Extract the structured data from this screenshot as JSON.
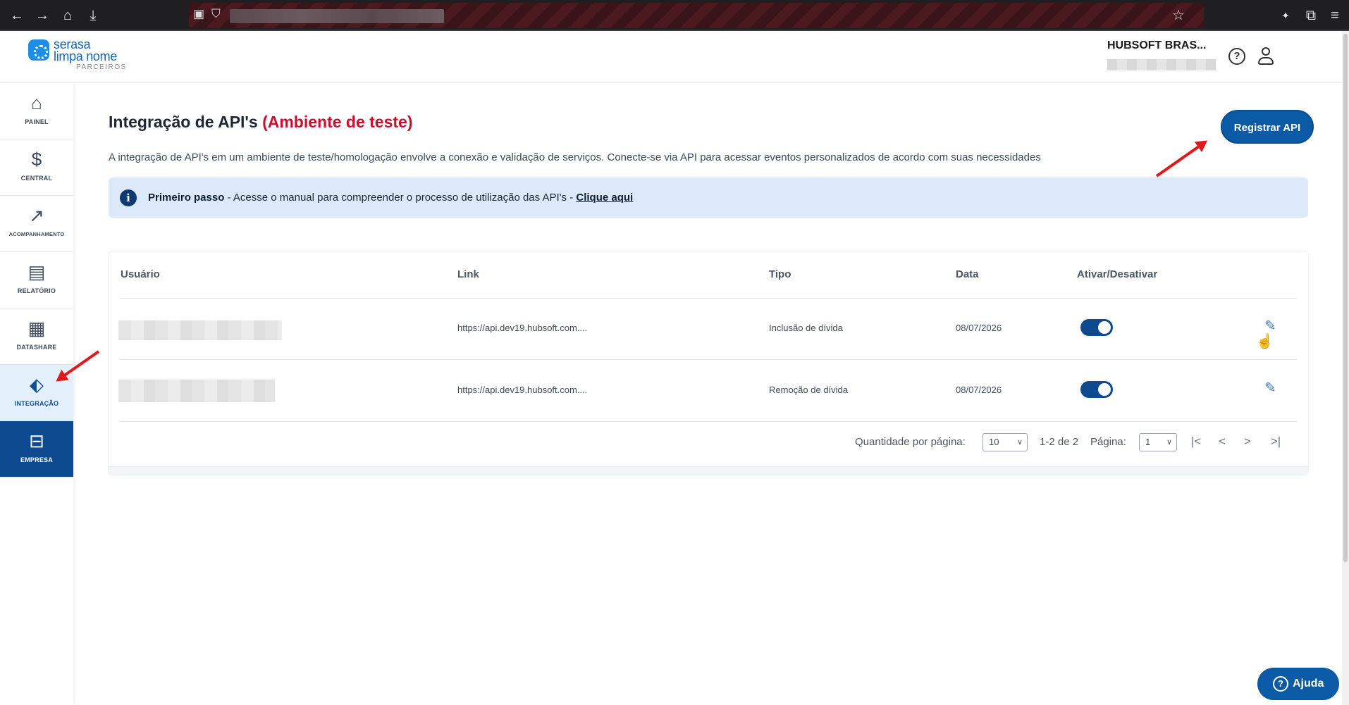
{
  "browser": {
    "back": "←",
    "forward": "→",
    "home": "⌂",
    "download": "⤓",
    "star": "☆",
    "menu": "≡"
  },
  "header": {
    "logo_line1": "serasa",
    "logo_line2": "limpa nome",
    "logo_line3": "PARCEIROS",
    "company_name": "HUBSOFT BRAS...",
    "help_symbol": "?"
  },
  "sidebar": {
    "items": [
      {
        "label": "PAINEL",
        "icon": "home-icon",
        "glyph": "⌂"
      },
      {
        "label": "CENTRAL",
        "icon": "money-hand-icon",
        "glyph": "$"
      },
      {
        "label": "ACOMPANHAMENTO",
        "icon": "trend-icon",
        "glyph": "↗"
      },
      {
        "label": "RELATÓRIO",
        "icon": "report-icon",
        "glyph": "▤"
      },
      {
        "label": "DATASHARE",
        "icon": "grid-icon",
        "glyph": "▦"
      },
      {
        "label": "INTEGRAÇÃO",
        "icon": "integration-icon",
        "glyph": "⬖"
      },
      {
        "label": "EMPRESA",
        "icon": "briefcase-icon",
        "glyph": "⊟"
      }
    ]
  },
  "main": {
    "title": "Integração de API's",
    "title_accent": "(Ambiente de teste)",
    "register_button": "Registrar API",
    "description": "A integração de API's em um ambiente de teste/homologação envolve a conexão e validação de serviços. Conecte-se via API para acessar eventos personalizados de acordo com suas necessidades",
    "info": {
      "icon": "i",
      "bold": "Primeiro passo",
      "text": " - Acesse o manual para compreender o processo de utilização das API's - ",
      "link": "Clique aqui"
    }
  },
  "table": {
    "headers": [
      "Usuário",
      "Link",
      "Tipo",
      "Data",
      "Ativar/Desativar"
    ],
    "rows": [
      {
        "link": "https://api.dev19.hubsoft.com....",
        "tipo": "Inclusão de dívida",
        "data": "08/07/2026",
        "active": true
      },
      {
        "link": "https://api.dev19.hubsoft.com....",
        "tipo": "Remoção de dívida",
        "data": "08/07/2026",
        "active": true
      }
    ],
    "pagination": {
      "per_page_label": "Quantidade por página:",
      "per_page_value": "10",
      "range": "1-2 de 2",
      "page_label": "Página:",
      "page_value": "1",
      "first": "|<",
      "prev": "<",
      "next": ">",
      "last": ">|"
    }
  },
  "help_fab": {
    "label": "Ajuda",
    "symbol": "?"
  },
  "colors": {
    "accent": "#c8102e",
    "primary": "#0b5aa6",
    "info_bg": "#dbe9fb",
    "annotation_arrow": "#e0191d"
  }
}
